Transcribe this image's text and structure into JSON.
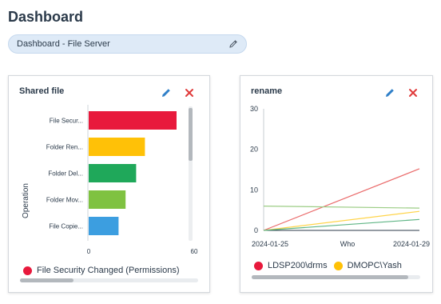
{
  "page": {
    "title": "Dashboard"
  },
  "dashboard_selector": {
    "value": "Dashboard - File Server"
  },
  "widgets": [
    {
      "title": "Shared file",
      "legend": [
        {
          "label": "File Security Changed (Permissions)",
          "color": "#e8193c"
        }
      ]
    },
    {
      "title": "rename",
      "legend": [
        {
          "label": "LDSP200\\drms",
          "color": "#e8193c"
        },
        {
          "label": "DMOPC\\Yash",
          "color": "#ffc107"
        }
      ]
    }
  ],
  "chart_data": [
    {
      "type": "bar",
      "orientation": "horizontal",
      "categories": [
        "File Secur...",
        "Folder Ren...",
        "Folder Del...",
        "Folder Mov...",
        "File Copie..."
      ],
      "values": [
        50,
        32,
        27,
        21,
        17
      ],
      "colors": [
        "#e8193c",
        "#ffc107",
        "#1fa85a",
        "#7fc241",
        "#3c9ee0"
      ],
      "ylabel": "Operation",
      "xlim": [
        0,
        60
      ],
      "xticks": [
        "0",
        "60"
      ]
    },
    {
      "type": "line",
      "x": [
        "2024-01-25",
        "2024-01-29"
      ],
      "xlabel": "Who",
      "ylim": [
        0,
        30
      ],
      "yticks": [
        "0",
        "10",
        "20",
        "30"
      ],
      "series": [
        {
          "values": [
            0,
            15.2
          ],
          "color": "#ea6b6b"
        },
        {
          "values": [
            6,
            5.5
          ],
          "color": "#9ccd85"
        },
        {
          "values": [
            0,
            4.7
          ],
          "color": "#ffd44a"
        },
        {
          "values": [
            0,
            2.7
          ],
          "color": "#5fb585"
        }
      ]
    }
  ]
}
